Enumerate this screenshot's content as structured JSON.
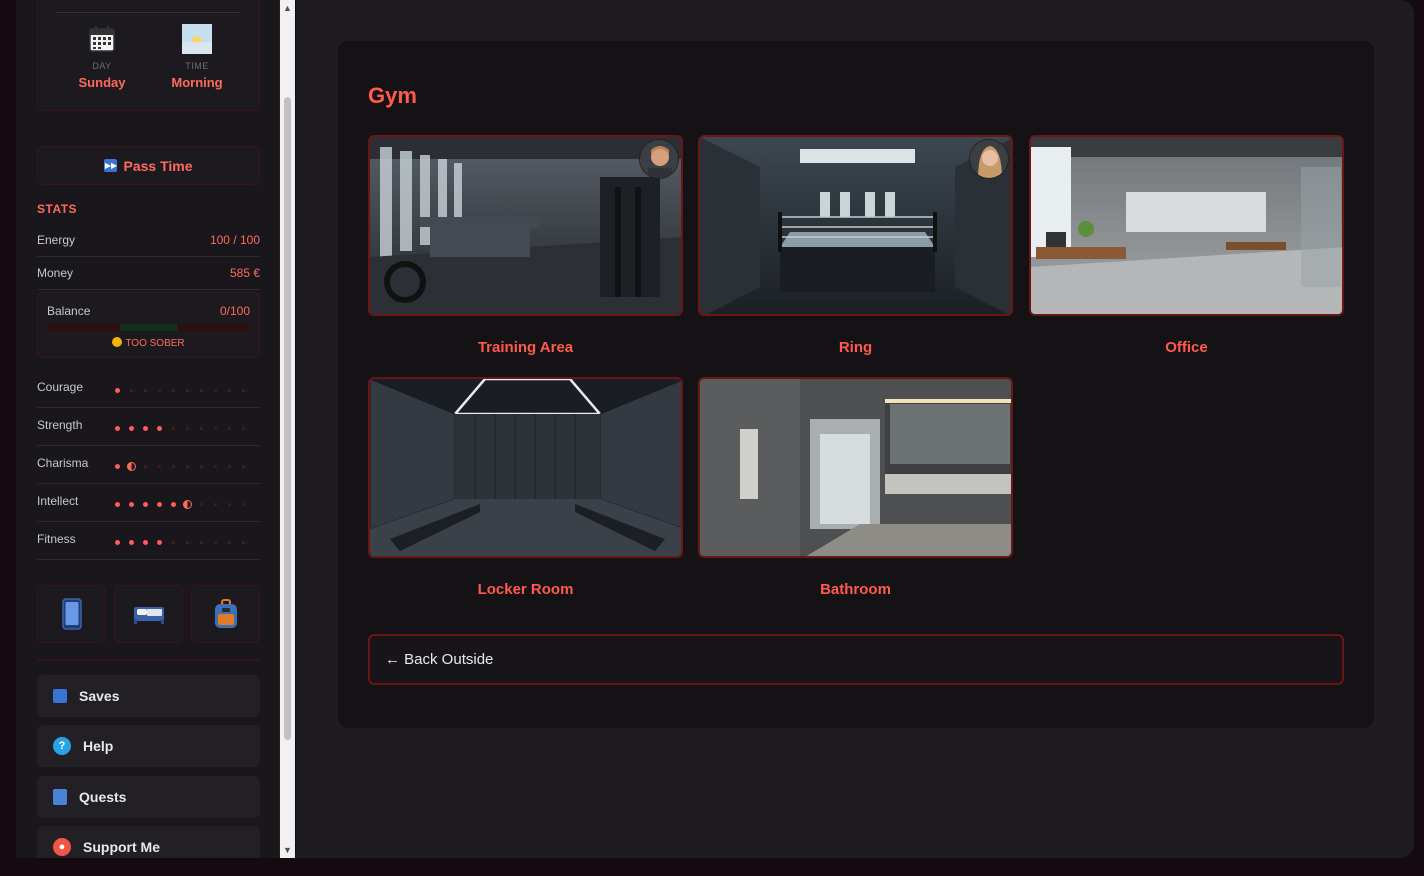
{
  "sidebar": {
    "day_label": "DAY",
    "day_value": "Sunday",
    "time_label": "TIME",
    "time_value": "Morning",
    "pass_time": "Pass Time",
    "stats_title": "STATS",
    "energy_label": "Energy",
    "energy_value": "100 / 100",
    "money_label": "Money",
    "money_value": "585 €",
    "balance_label": "Balance",
    "balance_value": "0/100",
    "balance_status": "TOO SOBER",
    "skills": [
      {
        "label": "Courage",
        "level": 1
      },
      {
        "label": "Strength",
        "level": 4
      },
      {
        "label": "Charisma",
        "level": 1.5
      },
      {
        "label": "Intellect",
        "level": 5.5
      },
      {
        "label": "Fitness",
        "level": 4
      }
    ],
    "skill_max": 10,
    "menu": {
      "saves": "Saves",
      "help": "Help",
      "quests": "Quests",
      "support": "Support Me"
    }
  },
  "main": {
    "title": "Gym",
    "locations": [
      {
        "name": "Training Area"
      },
      {
        "name": "Ring"
      },
      {
        "name": "Office"
      },
      {
        "name": "Locker Room"
      },
      {
        "name": "Bathroom"
      }
    ],
    "back_label": "← Back Outside"
  },
  "colors": {
    "accent": "#ff5a4c",
    "border": "#6b1515"
  }
}
